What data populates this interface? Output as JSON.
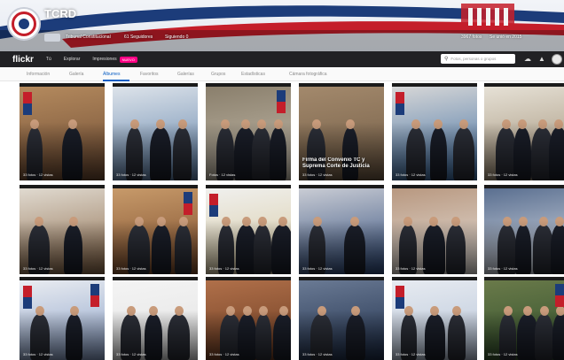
{
  "account": {
    "title": "TCRD",
    "stats": [
      "Tribunal Constitucional",
      "61 Seguidores",
      "Siguiendo 0"
    ],
    "right_stats": [
      "3967 fotos",
      "Se unió en 2015"
    ]
  },
  "nav": {
    "logo": "flickr",
    "links": [
      "Tú",
      "Explorar",
      "Impresiones"
    ],
    "new_badge": "NUEVO",
    "search_placeholder": "Fotos, personas o grupos"
  },
  "subnav": {
    "tabs": [
      "Información",
      "Galería",
      "Álbumes",
      "Favoritos",
      "Galerías",
      "Grupos",
      "Estadísticas",
      "Cámara fotográfica"
    ],
    "active_index": 2
  },
  "albums": [
    {
      "title": "",
      "meta": "33 fotos · 12 vistas"
    },
    {
      "title": "",
      "meta": "33 fotos · 12 vistas"
    },
    {
      "title": "",
      "meta": "Fotos · 12 vistas"
    },
    {
      "title": "Firma del Convenio TC y Suprema Corte de Justicia",
      "meta": "33 fotos · 12 vistas"
    },
    {
      "title": "",
      "meta": "33 fotos · 12 vistas"
    },
    {
      "title": "",
      "meta": "33 fotos · 12 vistas"
    },
    {
      "title": "",
      "meta": "33 fotos · 12 vistas"
    },
    {
      "title": "",
      "meta": "33 fotos · 12 vistas"
    },
    {
      "title": "",
      "meta": "33 fotos · 12 vistas"
    },
    {
      "title": "",
      "meta": "33 fotos · 12 vistas"
    },
    {
      "title": "",
      "meta": "33 fotos · 12 vistas"
    },
    {
      "title": "",
      "meta": "33 fotos · 12 vistas"
    },
    {
      "title": "",
      "meta": "33 fotos · 12 vistas"
    },
    {
      "title": "",
      "meta": "33 fotos · 12 vistas"
    },
    {
      "title": "",
      "meta": "33 fotos · 12 vistas"
    },
    {
      "title": "",
      "meta": "33 fotos · 12 vistas"
    },
    {
      "title": "",
      "meta": "33 fotos · 12 vistas"
    },
    {
      "title": "",
      "meta": "33 fotos · 12 vistas"
    }
  ],
  "colors": {
    "nav_bg": "#212124",
    "accent": "#0a5fc4",
    "new_badge": "#ff0084",
    "flag_red": "#c41e2a",
    "flag_blue": "#1c3c7a"
  },
  "icons": [
    "search-icon",
    "upload-icon",
    "notification-bell-icon",
    "user-avatar-icon"
  ]
}
